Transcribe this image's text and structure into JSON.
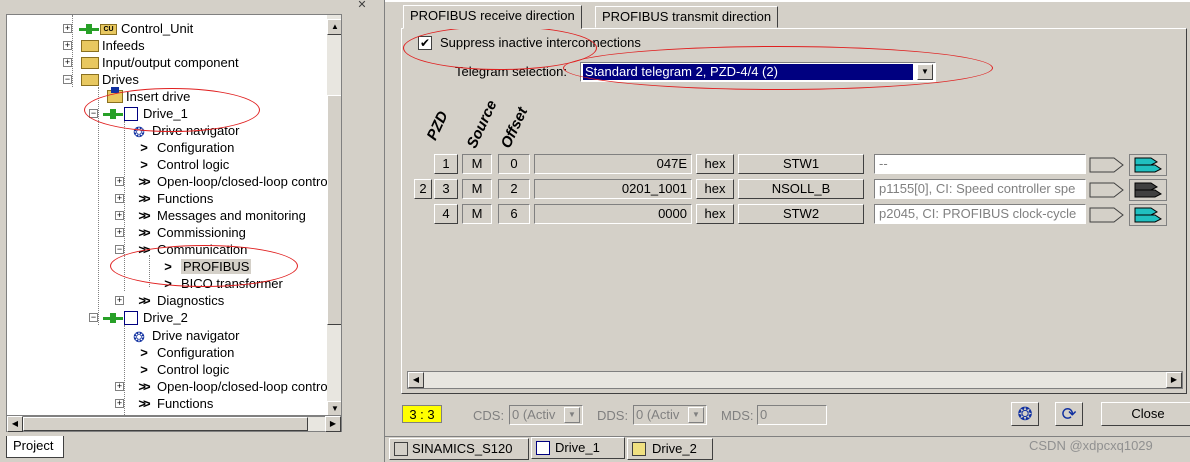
{
  "tree": {
    "items": [
      {
        "label": "Control_Unit",
        "badge": "CU"
      },
      {
        "label": "Infeeds"
      },
      {
        "label": "Input/output component"
      },
      {
        "label": "Drives"
      },
      {
        "label": "Insert drive"
      },
      {
        "label": "Drive_1"
      },
      {
        "label": "Drive navigator"
      },
      {
        "label": "Configuration"
      },
      {
        "label": "Control logic"
      },
      {
        "label": "Open-loop/closed-loop control"
      },
      {
        "label": "Functions"
      },
      {
        "label": "Messages and monitoring"
      },
      {
        "label": "Commissioning"
      },
      {
        "label": "Communication"
      },
      {
        "label": "PROFIBUS"
      },
      {
        "label": "BICO transformer"
      },
      {
        "label": "Diagnostics"
      },
      {
        "label": "Drive_2"
      },
      {
        "label": "Drive navigator"
      },
      {
        "label": "Configuration"
      },
      {
        "label": "Control logic"
      },
      {
        "label": "Open-loop/closed-loop control"
      },
      {
        "label": "Functions"
      }
    ],
    "bottom_tab": "Project"
  },
  "tabs": {
    "receive": "PROFIBUS receive direction",
    "transmit": "PROFIBUS transmit direction"
  },
  "suppress": {
    "label": "Suppress inactive interconnections",
    "checked": "✔"
  },
  "telegram": {
    "label": "Telegram selection:",
    "value": "Standard telegram 2, PZD-4/4 (2)"
  },
  "columns": {
    "pzd": "PZD",
    "source": "Source",
    "offset": "Offset"
  },
  "rows": [
    {
      "pzd_pre": "",
      "pzd": "1",
      "source": "M",
      "offset": "0",
      "value": "047E",
      "format": "hex",
      "signal": "STW1",
      "interconnect": "--"
    },
    {
      "pzd_pre": "2",
      "pzd": "3",
      "source": "M",
      "offset": "2",
      "value": "0201_1001",
      "format": "hex",
      "signal": "NSOLL_B",
      "interconnect": "p1155[0], CI: Speed controller spe"
    },
    {
      "pzd_pre": "",
      "pzd": "4",
      "source": "M",
      "offset": "6",
      "value": "0000",
      "format": "hex",
      "signal": "STW2",
      "interconnect": "p2045, CI: PROFIBUS clock-cycle"
    }
  ],
  "status": {
    "counter": "3 : 3",
    "cds_label": "CDS:",
    "cds_value": "0 (Activ",
    "dds_label": "DDS:",
    "dds_value": "0 (Activ",
    "mds_label": "MDS:",
    "mds_value": "0",
    "close": "Close"
  },
  "window_tabs": [
    "SINAMICS_S120",
    "Drive_1",
    "Drive_2"
  ],
  "watermark": "CSDN @xdpcxq1029",
  "colors": {
    "counter_bg": "#ffff00",
    "selection_bg": "#000080",
    "ellipse": "#e02020",
    "icon_blue": "#1030a0",
    "icon_cyan": "#20c0c0"
  }
}
